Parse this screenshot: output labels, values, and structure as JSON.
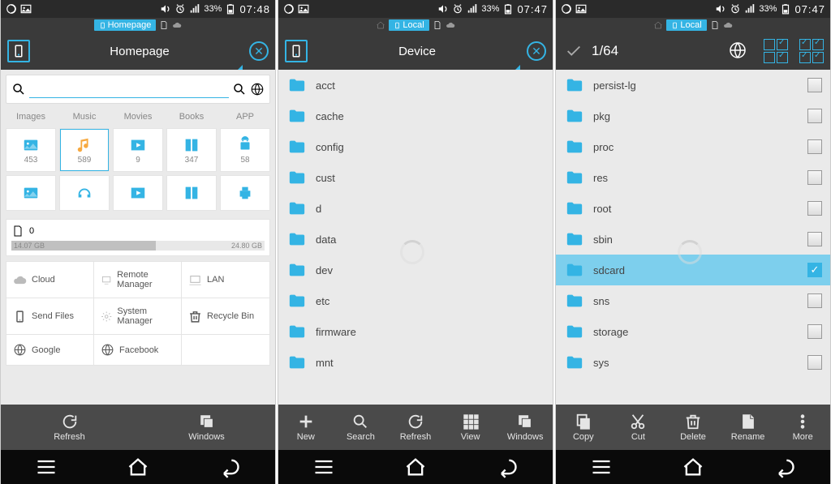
{
  "screen1": {
    "status": {
      "battery": "33%",
      "time": "07:48"
    },
    "breadcrumb": "Homepage",
    "title": "Homepage",
    "categories": [
      "Images",
      "Music",
      "Movies",
      "Books",
      "APP"
    ],
    "tiles": [
      {
        "count": "453"
      },
      {
        "count": "589"
      },
      {
        "count": "9"
      },
      {
        "count": "347"
      },
      {
        "count": "58"
      }
    ],
    "storage": {
      "label": "0",
      "used": "14.07 GB",
      "total": "24.80 GB"
    },
    "quick": [
      "Cloud",
      "Remote Manager",
      "LAN",
      "Send Files",
      "System Manager",
      "Recycle Bin",
      "Google",
      "Facebook"
    ],
    "toolbar": [
      "Refresh",
      "Windows"
    ]
  },
  "screen2": {
    "status": {
      "battery": "33%",
      "time": "07:47"
    },
    "breadcrumb": "Local",
    "title": "Device",
    "folders": [
      "acct",
      "cache",
      "config",
      "cust",
      "d",
      "data",
      "dev",
      "etc",
      "firmware",
      "mnt"
    ],
    "toolbar": [
      "New",
      "Search",
      "Refresh",
      "View",
      "Windows"
    ]
  },
  "screen3": {
    "status": {
      "battery": "33%",
      "time": "07:47"
    },
    "breadcrumb": "Local",
    "selection": "1/64",
    "folders": [
      {
        "name": "persist-lg",
        "selected": false
      },
      {
        "name": "pkg",
        "selected": false
      },
      {
        "name": "proc",
        "selected": false
      },
      {
        "name": "res",
        "selected": false
      },
      {
        "name": "root",
        "selected": false
      },
      {
        "name": "sbin",
        "selected": false
      },
      {
        "name": "sdcard",
        "selected": true
      },
      {
        "name": "sns",
        "selected": false
      },
      {
        "name": "storage",
        "selected": false
      },
      {
        "name": "sys",
        "selected": false
      }
    ],
    "toolbar": [
      "Copy",
      "Cut",
      "Delete",
      "Rename",
      "More"
    ]
  }
}
